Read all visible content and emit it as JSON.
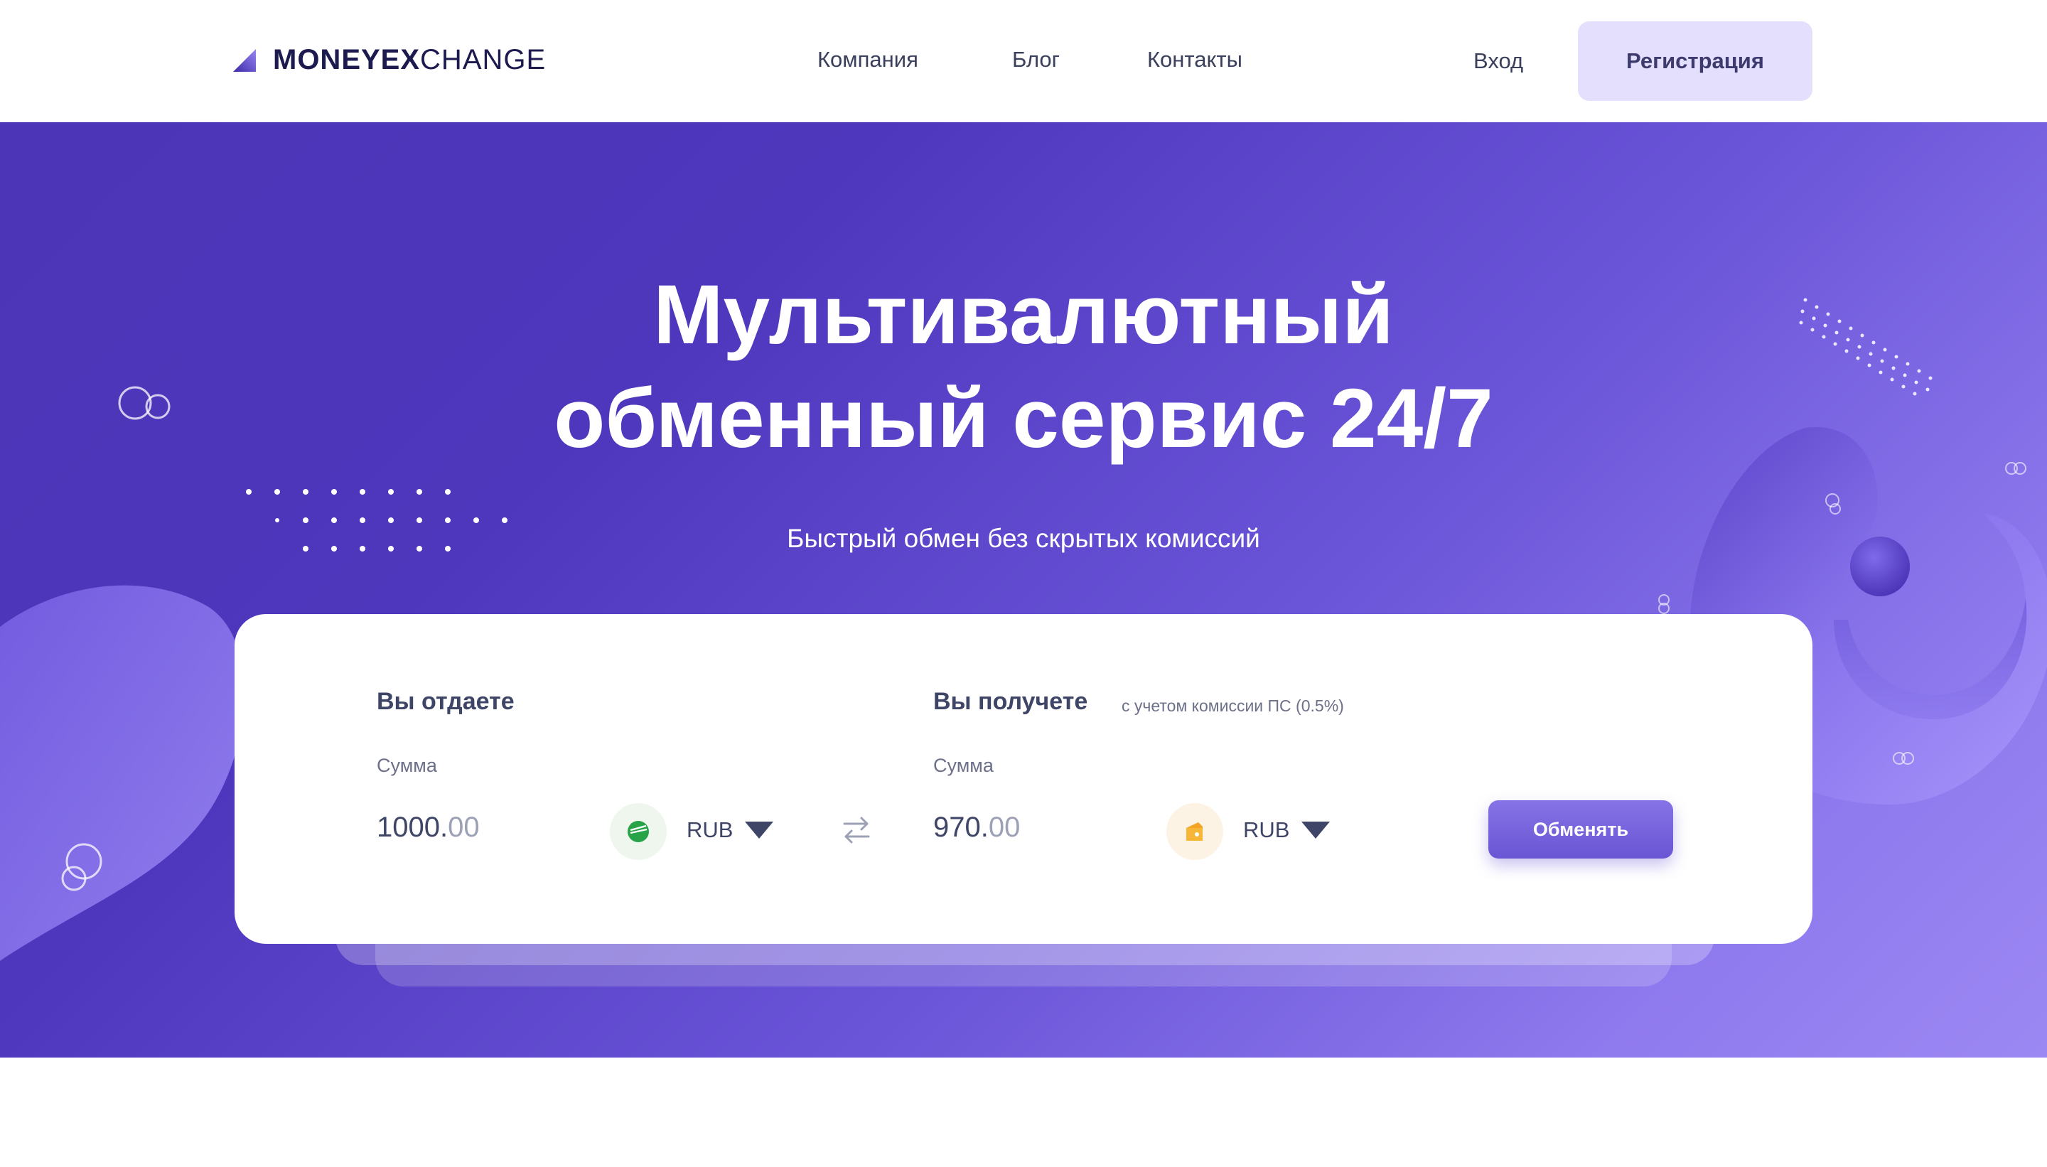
{
  "header": {
    "logo": {
      "bold": "MONEYEX",
      "light": "CHANGE"
    },
    "nav": [
      {
        "label": "Компания"
      },
      {
        "label": "Блог"
      },
      {
        "label": "Контакты"
      }
    ],
    "login_label": "Вход",
    "register_label": "Регистрация"
  },
  "hero": {
    "title_line1": "Мультивалютный",
    "title_line2": "обменный сервис 24/7",
    "subtitle": "Быстрый обмен без скрытых комиссий"
  },
  "exchange": {
    "give": {
      "title": "Вы отдаете",
      "amount_label": "Сумма",
      "amount_int": "1000.",
      "amount_dec": "00",
      "currency": "RUB",
      "icon": "sberbank-icon"
    },
    "receive": {
      "title": "Вы получете",
      "note": "с учетом комиссии ПС (0.5%)",
      "amount_label": "Сумма",
      "amount_int": "970.",
      "amount_dec": "00",
      "currency": "RUB",
      "icon": "yandex-money-icon"
    },
    "button_label": "Обменять"
  },
  "colors": {
    "accent": "#6a55d3",
    "hero_start": "#4c35b6",
    "hero_end": "#9c88f3",
    "register_bg": "#e4dffd"
  }
}
